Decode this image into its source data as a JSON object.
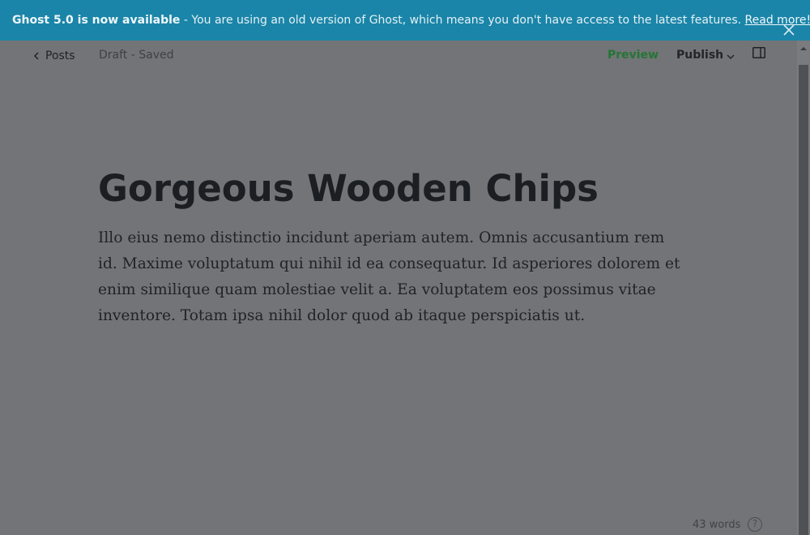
{
  "banner": {
    "headline": "Ghost 5.0 is now available",
    "message": " - You are using an old version of Ghost, which means you don't have access to the latest features. ",
    "link_label": "Read more!"
  },
  "header": {
    "back_label": "Posts",
    "status": "Draft - Saved",
    "preview_label": "Preview",
    "publish_label": "Publish"
  },
  "post": {
    "title": "Gorgeous Wooden Chips",
    "body": "Illo eius nemo distinctio incidunt aperiam autem. Omnis accusantium rem id. Maxime voluptatum qui nihil id ea consequatur. Id asperiores dolorem et enim similique quam molestiae velit a. Ea voluptatem eos possimus vitae inventore. Totam ipsa nihil dolor quod ab itaque perspiciatis ut."
  },
  "footer": {
    "word_count": "43 words",
    "help_label": "?"
  },
  "icons": {
    "close": "close-icon",
    "back": "chevron-left-icon",
    "publish_dropdown": "chevron-down-icon",
    "sidebar": "sidebar-toggle-icon",
    "help": "help-icon"
  },
  "colors": {
    "banner_bg": "#1a85a8",
    "overlay_bg": "#727477",
    "preview_text": "#247634"
  }
}
